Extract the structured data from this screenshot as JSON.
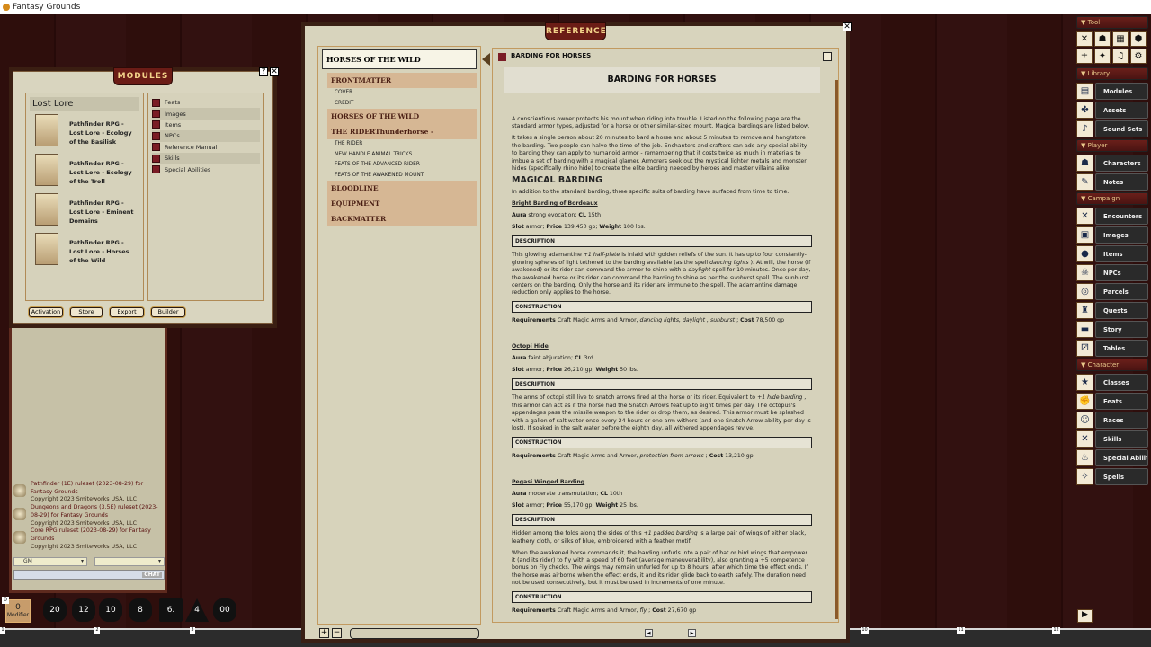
{
  "app": {
    "title": "Fantasy Grounds"
  },
  "modules": {
    "title": "MODULES",
    "help": "?",
    "close": "✕",
    "group": "Lost Lore",
    "items": [
      "Pathfinder RPG - Lost Lore - Ecology of the Basilisk",
      "Pathfinder RPG - Lost Lore - Ecology of the Troll",
      "Pathfinder RPG - Lost Lore - Eminent Domains",
      "Pathfinder RPG - Lost Lore - Horses of the Wild"
    ],
    "categories": [
      "Feats",
      "Images",
      "Items",
      "NPCs",
      "Reference Manual",
      "Skills",
      "Special Abilities"
    ],
    "buttons": [
      "Activation",
      "Store",
      "Export",
      "Builder"
    ]
  },
  "chat": {
    "messages": [
      {
        "text": "Pathfinder (1E) ruleset (2023-08-29) for Fantasy Grounds",
        "copyright": "Copyright 2023 Smiteworks USA, LLC"
      },
      {
        "text": "Dungeons and Dragons (3.5E) ruleset (2023-08-29) for Fantasy Grounds",
        "copyright": "Copyright 2023 Smiteworks USA, LLC"
      },
      {
        "text": "Core RPG ruleset (2023-08-29) for Fantasy Grounds",
        "copyright": "Copyright 2023 Smiteworks USA, LLC"
      }
    ],
    "identity": "GM",
    "language": "",
    "input": "",
    "chat_label": "CHAT"
  },
  "dice": {
    "modifier_value": "0",
    "modifier_label": "Modifier",
    "lock": "0",
    "dice": [
      "20",
      "12",
      "10",
      "8",
      "6.",
      "4",
      "00"
    ]
  },
  "hotkeys": [
    "1",
    "2",
    "3",
    "10",
    "11",
    "12"
  ],
  "reference": {
    "title": "REFERENCE",
    "close": "✕",
    "toc": {
      "title": "HORSES OF THE WILD",
      "sections": [
        {
          "label": "FRONTMATTER",
          "subs": [
            "COVER",
            "CREDIT"
          ]
        },
        {
          "label": "HORSES OF THE WILD",
          "subs": []
        },
        {
          "label": "THE RIDERThunderhorse -",
          "subs": [
            "THE RIDER",
            "NEW HANDLE ANIMAL TRICKS",
            "FEATS OF THE ADVANCED RIDER",
            "FEATS OF THE AWAKENED MOUNT"
          ]
        },
        {
          "label": "BLOODLINE",
          "subs": []
        },
        {
          "label": "EQUIPMENT",
          "subs": []
        },
        {
          "label": "BACKMATTER",
          "subs": []
        }
      ]
    },
    "page_name": "BARDING FOR HORSES",
    "heading": "BARDING FOR HORSES",
    "blocks": [
      {
        "type": "p",
        "segs": [
          {
            "t": "A conscientious owner protects his mount when riding into trouble. Listed on the following page are the standard armor types, adjusted for a horse or other similar-sized mount. Magical bardings are listed below."
          }
        ]
      },
      {
        "type": "p",
        "segs": [
          {
            "t": "It takes a single person about 20 minutes to bard a horse and about 5 minutes to remove and hang/store the barding. Two people can halve the time of the job. Enchanters and crafters can add any special ability to barding they can apply to humanoid armor - remembering that it costs twice as much in materials to imbue a set of barding with a magical glamer. Armorers seek out the mystical lighter metals and monster hides (specifically rhino hide) to create the elite barding needed by heroes and master villains alike."
          }
        ]
      },
      {
        "type": "h2",
        "text": "MAGICAL BARDING"
      },
      {
        "type": "p",
        "segs": [
          {
            "t": "In addition to the standard barding, three specific suits of barding have surfaced from time to time."
          }
        ]
      },
      {
        "type": "link",
        "text": "Bright Barding of Bordeaux"
      },
      {
        "type": "p",
        "segs": [
          {
            "t": "Aura",
            "b": 1
          },
          {
            "t": " strong evocation; "
          },
          {
            "t": "CL",
            "b": 1
          },
          {
            "t": " 15th"
          }
        ]
      },
      {
        "type": "p",
        "segs": [
          {
            "t": "Slot",
            "b": 1
          },
          {
            "t": " armor; "
          },
          {
            "t": "Price",
            "b": 1
          },
          {
            "t": " 139,450 gp; "
          },
          {
            "t": "Weight",
            "b": 1
          },
          {
            "t": " 100 lbs."
          }
        ]
      },
      {
        "type": "box",
        "text": "DESCRIPTION"
      },
      {
        "type": "p",
        "segs": [
          {
            "t": "This glowing adamantine "
          },
          {
            "t": "+1 half-plate",
            "i": 1
          },
          {
            "t": " is inlaid with golden reliefs of the sun. It has up to four constantly-glowing spheres of light tethered to the barding available (as the spell "
          },
          {
            "t": "dancing lights",
            "i": 1
          },
          {
            "t": " ). At will, the horse (if awakened) or its rider can command the armor to shine with a "
          },
          {
            "t": "daylight",
            "i": 1
          },
          {
            "t": " spell for 10 minutes. Once per day, the awakened horse or its rider can command the barding to shine as per the "
          },
          {
            "t": "sunburst",
            "i": 1
          },
          {
            "t": " spell. The sunburst centers on the barding. Only the horse and its rider are immune to the spell. The adamantine damage reduction only applies to the horse."
          }
        ]
      },
      {
        "type": "box",
        "text": "CONSTRUCTION"
      },
      {
        "type": "p",
        "segs": [
          {
            "t": "Requirements",
            "b": 1
          },
          {
            "t": " Craft Magic Arms and Armor, "
          },
          {
            "t": "dancing lights, daylight , sunburst",
            "i": 1
          },
          {
            "t": " ; "
          },
          {
            "t": "Cost",
            "b": 1
          },
          {
            "t": " 78,500 gp"
          }
        ]
      },
      {
        "type": "gap"
      },
      {
        "type": "link",
        "text": "Octopi Hide"
      },
      {
        "type": "p",
        "segs": [
          {
            "t": "Aura",
            "b": 1
          },
          {
            "t": " faint abjuration; "
          },
          {
            "t": "CL",
            "b": 1
          },
          {
            "t": " 3rd"
          }
        ]
      },
      {
        "type": "p",
        "segs": [
          {
            "t": "Slot",
            "b": 1
          },
          {
            "t": " armor; "
          },
          {
            "t": "Price",
            "b": 1
          },
          {
            "t": " 26,210 gp; "
          },
          {
            "t": "Weight",
            "b": 1
          },
          {
            "t": " 50 lbs."
          }
        ]
      },
      {
        "type": "box",
        "text": "DESCRIPTION"
      },
      {
        "type": "p",
        "segs": [
          {
            "t": "The arms of octopi still live to snatch arrows fired at the horse or its rider. Equivalent to "
          },
          {
            "t": "+1 hide barding",
            "i": 1
          },
          {
            "t": " , this armor can act as if the horse had the Snatch Arrows feat up to eight times per day. The octopus's appendages pass the missile weapon to the rider or drop them, as desired. This armor must be splashed with a gallon of salt water once every 24 hours or one arm withers (and one Snatch Arrow ability per day is lost). If soaked in the salt water before the eighth day, all withered appendages revive."
          }
        ]
      },
      {
        "type": "box",
        "text": "CONSTRUCTION"
      },
      {
        "type": "p",
        "segs": [
          {
            "t": "Requirements",
            "b": 1
          },
          {
            "t": " Craft Magic Arms and Armor, "
          },
          {
            "t": "protection from arrows",
            "i": 1
          },
          {
            "t": " ; "
          },
          {
            "t": "Cost",
            "b": 1
          },
          {
            "t": " 13,210 gp"
          }
        ]
      },
      {
        "type": "gap"
      },
      {
        "type": "link",
        "text": "Pegasi Winged Barding"
      },
      {
        "type": "p",
        "segs": [
          {
            "t": "Aura",
            "b": 1
          },
          {
            "t": " moderate transmutation; "
          },
          {
            "t": "CL",
            "b": 1
          },
          {
            "t": " 10th"
          }
        ]
      },
      {
        "type": "p",
        "segs": [
          {
            "t": "Slot",
            "b": 1
          },
          {
            "t": " armor; "
          },
          {
            "t": "Price",
            "b": 1
          },
          {
            "t": " 55,170 gp; "
          },
          {
            "t": "Weight",
            "b": 1
          },
          {
            "t": " 25 lbs."
          }
        ]
      },
      {
        "type": "box",
        "text": "DESCRIPTION"
      },
      {
        "type": "p",
        "segs": [
          {
            "t": "Hidden among the folds along the sides of this "
          },
          {
            "t": "+1 padded barding",
            "i": 1
          },
          {
            "t": " is a large pair of wings of either black, leathery cloth, or silks of blue, embroidered with a feather motif."
          }
        ]
      },
      {
        "type": "p",
        "segs": [
          {
            "t": "When the awakened horse commands it, the barding unfurls into a pair of bat or bird wings that empower it (and its rider) to fly with a speed of 60 feet (average maneuverability), also granting a +5 competence bonus on Fly checks. The wings may remain unfurled for up to 8 hours, after which time the effect ends. If the horse was airborne when the effect ends, it and its rider glide back to earth safely. The duration need not be used consecutively, but it must be used in increments of one minute."
          }
        ]
      },
      {
        "type": "box",
        "text": "CONSTRUCTION"
      },
      {
        "type": "p",
        "segs": [
          {
            "t": "Requirements",
            "b": 1
          },
          {
            "t": " Craft Magic Arms and Armor, "
          },
          {
            "t": "fly",
            "i": 1
          },
          {
            "t": " ; "
          },
          {
            "t": "Cost",
            "b": 1
          },
          {
            "t": " 27,670 gp"
          }
        ]
      }
    ],
    "footer": {
      "add": "+",
      "remove": "−",
      "search": "",
      "prev": "◀",
      "next": "▶"
    }
  },
  "sidebar": {
    "sections": [
      {
        "label": "Tool",
        "tools": [
          {
            "icon": "combat-tracker-icon",
            "g": "✕"
          },
          {
            "icon": "party-icon",
            "g": "☗"
          },
          {
            "icon": "calendar-icon",
            "g": "▦"
          },
          {
            "icon": "dice-icon",
            "g": "⬢"
          },
          {
            "icon": "modifiers-icon",
            "g": "±"
          },
          {
            "icon": "effects-icon",
            "g": "✦"
          },
          {
            "icon": "music-icon",
            "g": "♫"
          },
          {
            "icon": "settings-icon",
            "g": "⚙"
          }
        ]
      },
      {
        "label": "Library",
        "items": [
          {
            "label": "Modules",
            "g": "▤"
          },
          {
            "label": "Assets",
            "g": "✤"
          },
          {
            "label": "Sound Sets",
            "g": "♪"
          }
        ]
      },
      {
        "label": "Player",
        "items": [
          {
            "label": "Characters",
            "g": "☗"
          },
          {
            "label": "Notes",
            "g": "✎"
          }
        ]
      },
      {
        "label": "Campaign",
        "items": [
          {
            "label": "Encounters",
            "g": "✕"
          },
          {
            "label": "Images",
            "g": "▣"
          },
          {
            "label": "Items",
            "g": "●"
          },
          {
            "label": "NPCs",
            "g": "☠"
          },
          {
            "label": "Parcels",
            "g": "◎"
          },
          {
            "label": "Quests",
            "g": "♜"
          },
          {
            "label": "Story",
            "g": "▬"
          },
          {
            "label": "Tables",
            "g": "⚂"
          }
        ]
      },
      {
        "label": "Character",
        "items": [
          {
            "label": "Classes",
            "g": "★"
          },
          {
            "label": "Feats",
            "g": "✊"
          },
          {
            "label": "Races",
            "g": "☺"
          },
          {
            "label": "Skills",
            "g": "✕"
          },
          {
            "label": "Special Abilitie",
            "g": "♨"
          },
          {
            "label": "Spells",
            "g": "✧"
          }
        ]
      }
    ],
    "play": "▶"
  },
  "colors": {
    "background": "#2b0d0b",
    "parchment": "#d9d5bf",
    "title_tab": "#6b1c16",
    "toc_section": "#d6b794",
    "sidebar_header": "#6a1f1a"
  }
}
